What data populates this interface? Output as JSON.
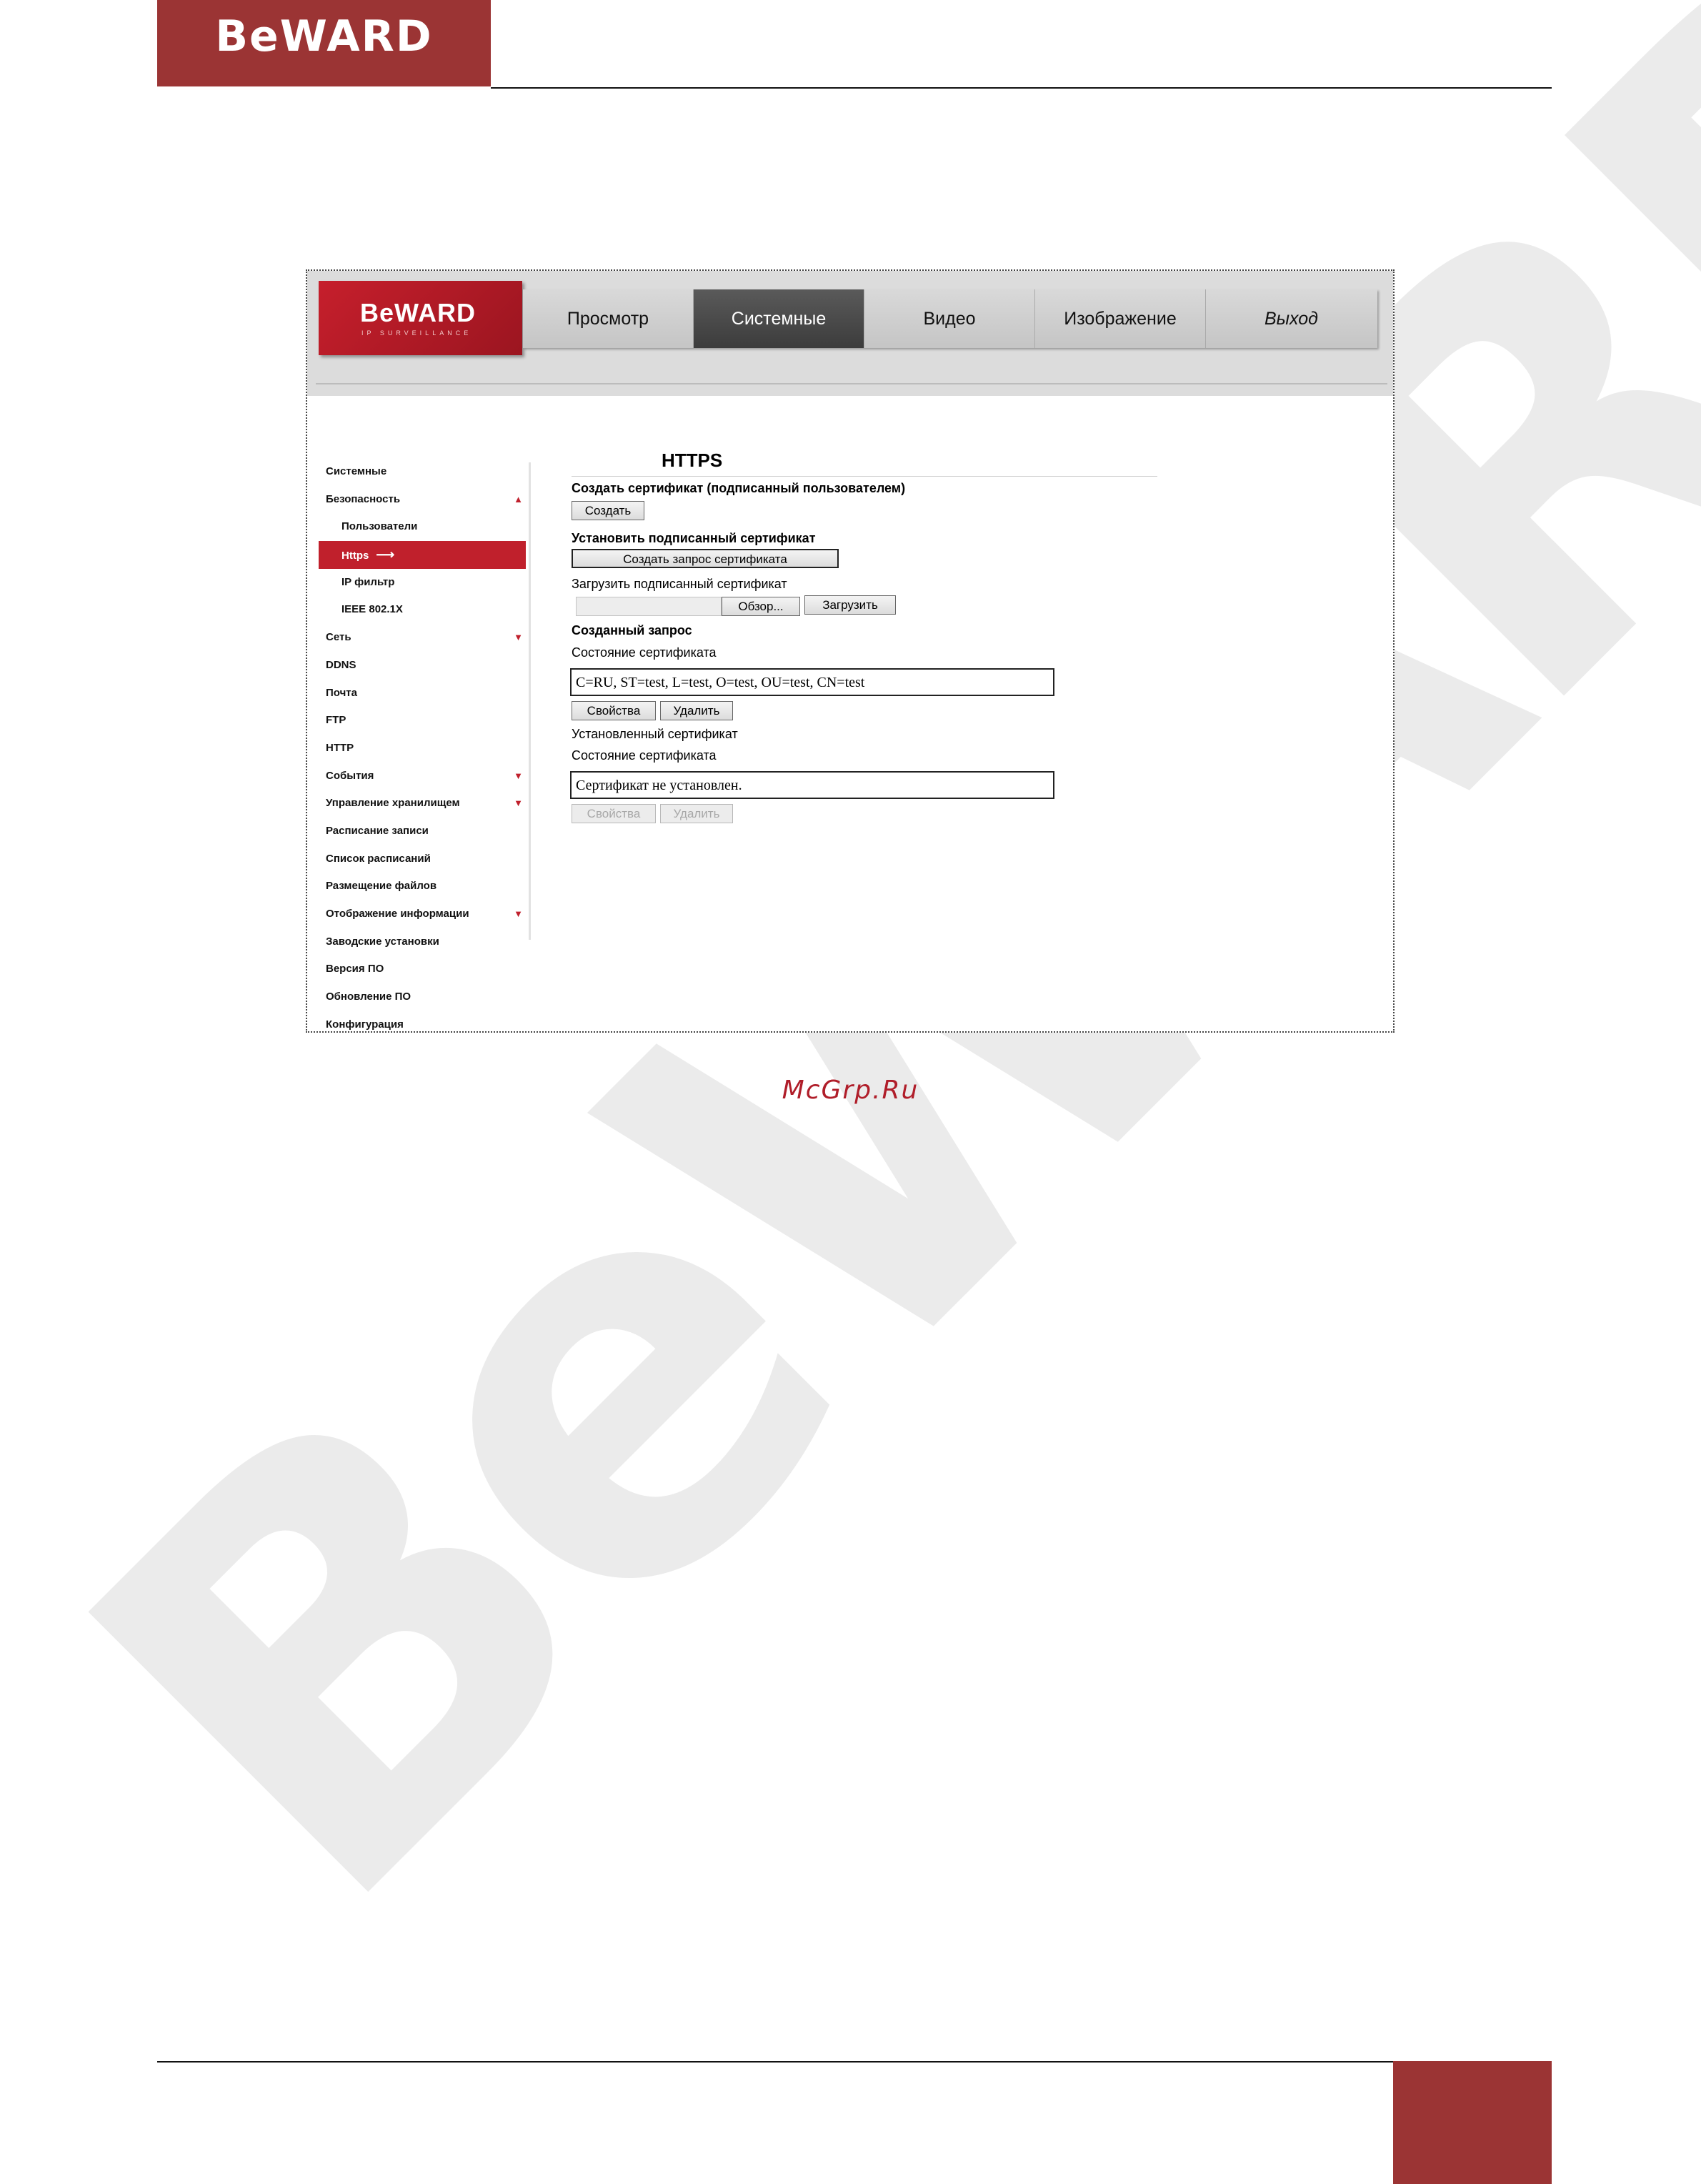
{
  "document": {
    "header_logo": "BeWARD",
    "watermark": "BeWARD",
    "source_link": "McGrp.Ru"
  },
  "app": {
    "brand_name": "BeWARD",
    "brand_tagline": "IP SURVEILLANCE",
    "nav_tabs": [
      {
        "label": "Просмотр",
        "active": false
      },
      {
        "label": "Системные",
        "active": true
      },
      {
        "label": "Видео",
        "active": false
      },
      {
        "label": "Изображение",
        "active": false
      },
      {
        "label": "Выход",
        "active": false
      }
    ],
    "sidebar": {
      "items": [
        {
          "label": "Системные"
        },
        {
          "label": "Безопасность",
          "arrow": "▲"
        },
        {
          "label": "Пользователи"
        },
        {
          "label": "Https",
          "active": true,
          "marker": "⟶"
        },
        {
          "label": "IP фильтр"
        },
        {
          "label": "IEEE 802.1X"
        },
        {
          "label": "Сеть",
          "arrow": "▼"
        },
        {
          "label": "DDNS"
        },
        {
          "label": "Почта"
        },
        {
          "label": "FTP"
        },
        {
          "label": "HTTP"
        },
        {
          "label": "События",
          "arrow": "▼"
        },
        {
          "label": "Управление хранилищем",
          "arrow": "▼"
        },
        {
          "label": "Расписание записи"
        },
        {
          "label": "Список расписаний"
        },
        {
          "label": "Размещение файлов"
        },
        {
          "label": "Отображение информации",
          "arrow": "▼"
        },
        {
          "label": "Заводские установки"
        },
        {
          "label": "Версия ПО"
        },
        {
          "label": "Обновление ПО"
        },
        {
          "label": "Конфигурация"
        }
      ]
    },
    "main": {
      "title": "HTTPS",
      "create_self_signed_heading": "Создать сертификат (подписанный пользователем)",
      "create_button": "Создать",
      "install_signed_heading": "Установить подписанный сертификат",
      "create_request_button": "Создать запрос сертификата",
      "upload_signed_label": "Загрузить подписанный сертификат",
      "browse_button": "Обзор...",
      "upload_button": "Загрузить",
      "created_request_heading": "Созданный запрос",
      "cert_status_label_1": "Состояние сертификата",
      "request_status_value": "C=RU, ST=test, L=test, O=test, OU=test, CN=test",
      "properties_button_1": "Свойства",
      "delete_button_1": "Удалить",
      "installed_cert_label": "Установленный сертификат",
      "cert_status_label_2": "Состояние сертификата",
      "installed_status_value": "Сертификат не установлен.",
      "properties_button_2": "Свойства",
      "delete_button_2": "Удалить"
    }
  },
  "colors": {
    "brand_red": "#9b3434",
    "active_red": "#c0202c",
    "nav_active": "#4a4a4a"
  }
}
